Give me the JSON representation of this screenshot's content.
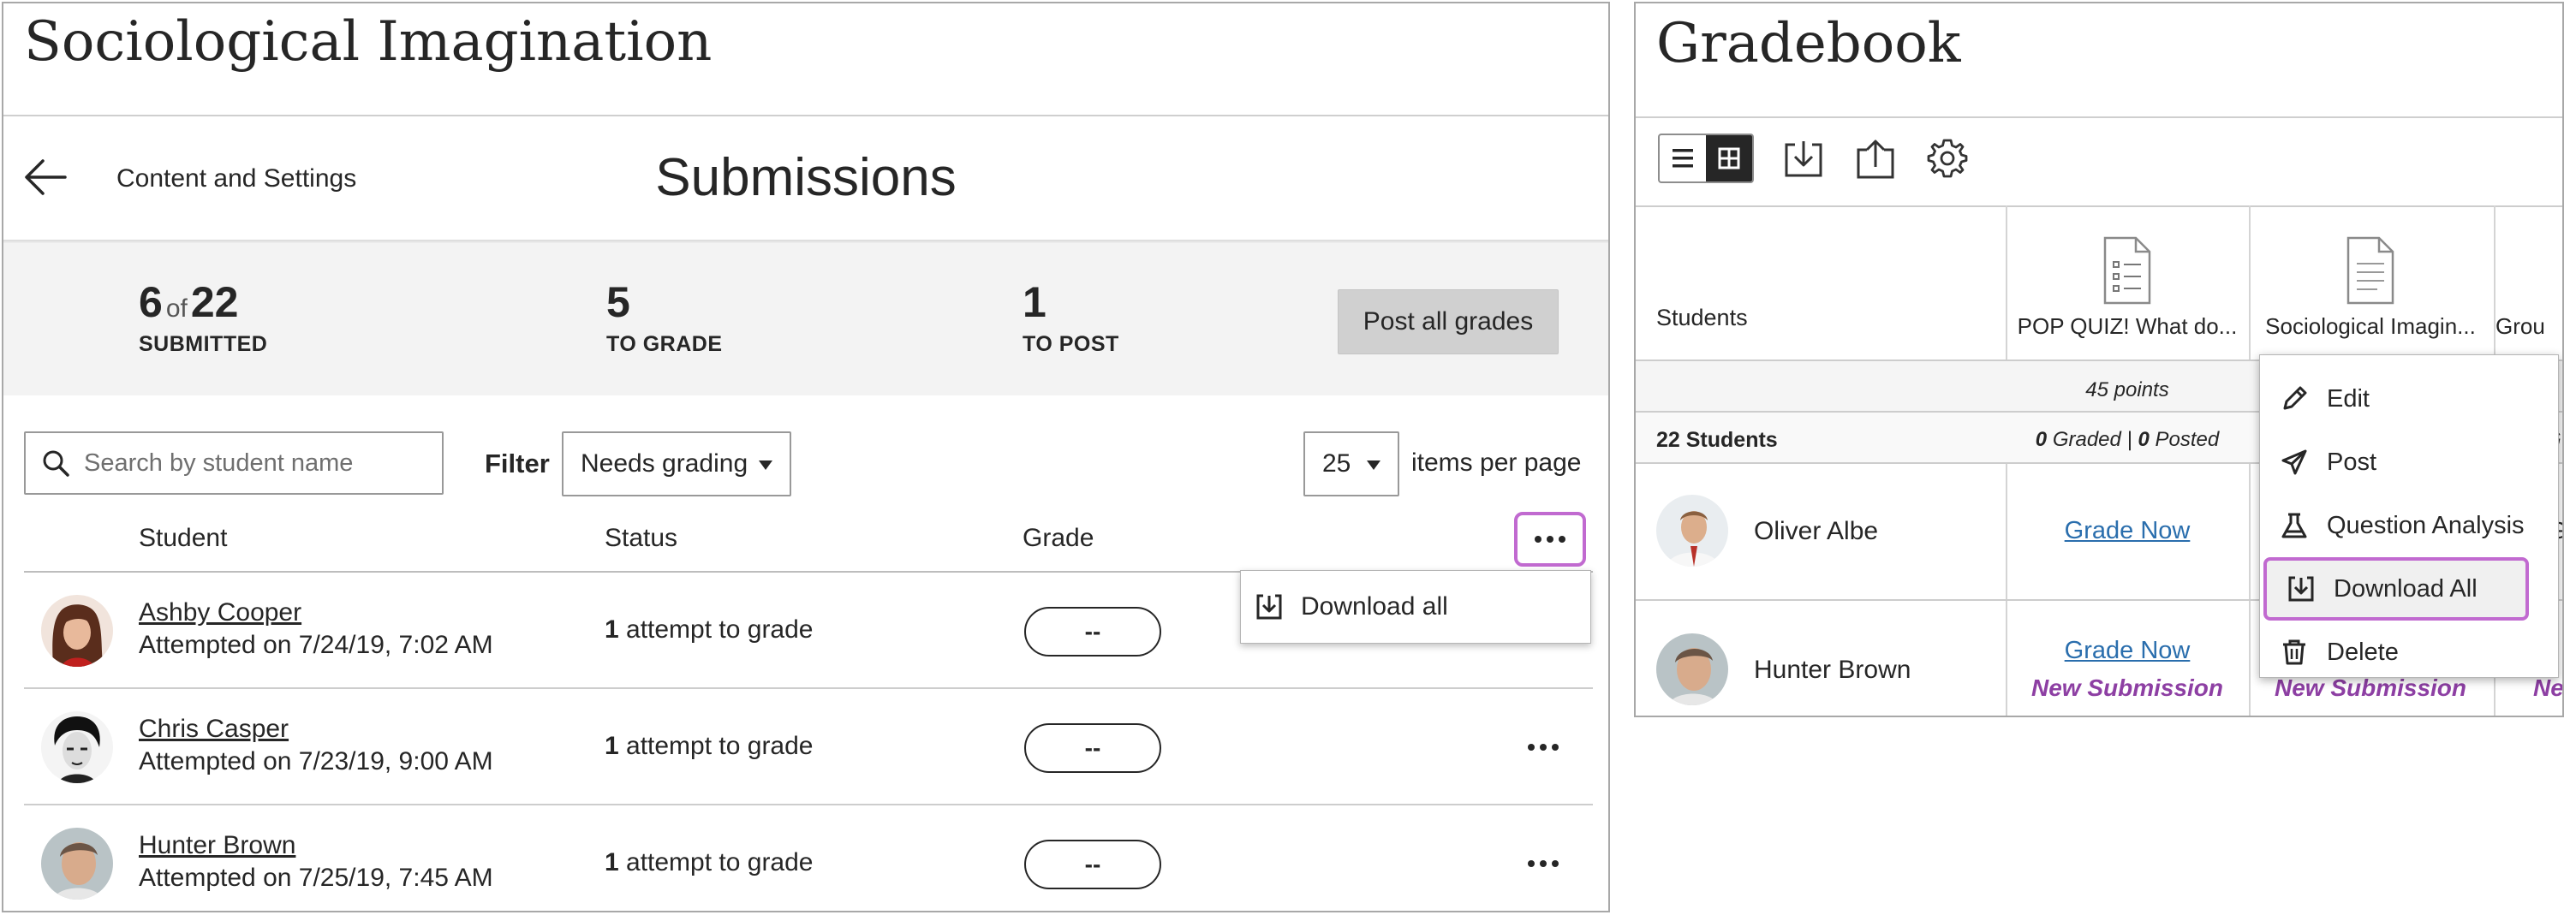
{
  "submissions": {
    "course_title": "Sociological Imagination",
    "back_label": "Content and Settings",
    "page_title": "Submissions",
    "stats": {
      "submitted": "6",
      "of": "of",
      "total": "22",
      "submitted_label": "SUBMITTED",
      "to_grade": "5",
      "to_grade_label": "TO GRADE",
      "to_post": "1",
      "to_post_label": "TO POST"
    },
    "post_all_label": "Post all grades",
    "search_placeholder": "Search by student name",
    "filter_label": "Filter",
    "filter_value": "Needs grading",
    "per_page_value": "25",
    "per_page_label": "items per page",
    "columns": {
      "student": "Student",
      "status": "Status",
      "grade": "Grade"
    },
    "download_all_label": "Download all",
    "rows": [
      {
        "name": "Ashby Cooper",
        "attempted": "Attempted on 7/24/19, 7:02 AM",
        "count": "1",
        "status_text": " attempt to grade",
        "grade": "--"
      },
      {
        "name": "Chris Casper",
        "attempted": "Attempted on 7/23/19, 9:00 AM",
        "count": "1",
        "status_text": " attempt to grade",
        "grade": "--"
      },
      {
        "name": "Hunter Brown",
        "attempted": "Attempted on 7/25/19, 7:45 AM",
        "count": "1",
        "status_text": " attempt to grade",
        "grade": "--"
      }
    ]
  },
  "gradebook": {
    "title": "Gradebook",
    "students_header": "Students",
    "columns": [
      "POP QUIZ! What do...",
      "Sociological Imagin...",
      "Grou"
    ],
    "points": "45 points",
    "student_count": "22",
    "student_count_label": " Students",
    "graded_count": "0",
    "graded_label": " Graded | ",
    "posted_count": "0",
    "posted_label": " Posted",
    "rows": [
      {
        "name": "Oliver Albe",
        "grade_now": "Grade Now"
      },
      {
        "name": "Hunter Brown",
        "grade_now": "Grade Now",
        "new_submission": "New Submission",
        "new_submission_2": "New Submission",
        "edge_partial": "Ne"
      }
    ],
    "edge_row_partial": "G",
    "edge_count_partial": "G",
    "menu": [
      "Edit",
      "Post",
      "Question Analysis",
      "Download All",
      "Delete"
    ]
  },
  "colors": {
    "accent_highlight": "#c16ad0",
    "link": "#2a6ead",
    "new_submission": "#8d3fa3",
    "button_gray": "#d0d0d0"
  },
  "icons": [
    "back-arrow-icon",
    "search-icon",
    "more-dots-icon",
    "download-icon",
    "list-view-icon",
    "grid-view-icon",
    "upload-icon",
    "gear-icon",
    "document-icon",
    "pencil-icon",
    "send-icon",
    "flask-icon",
    "trash-icon"
  ]
}
